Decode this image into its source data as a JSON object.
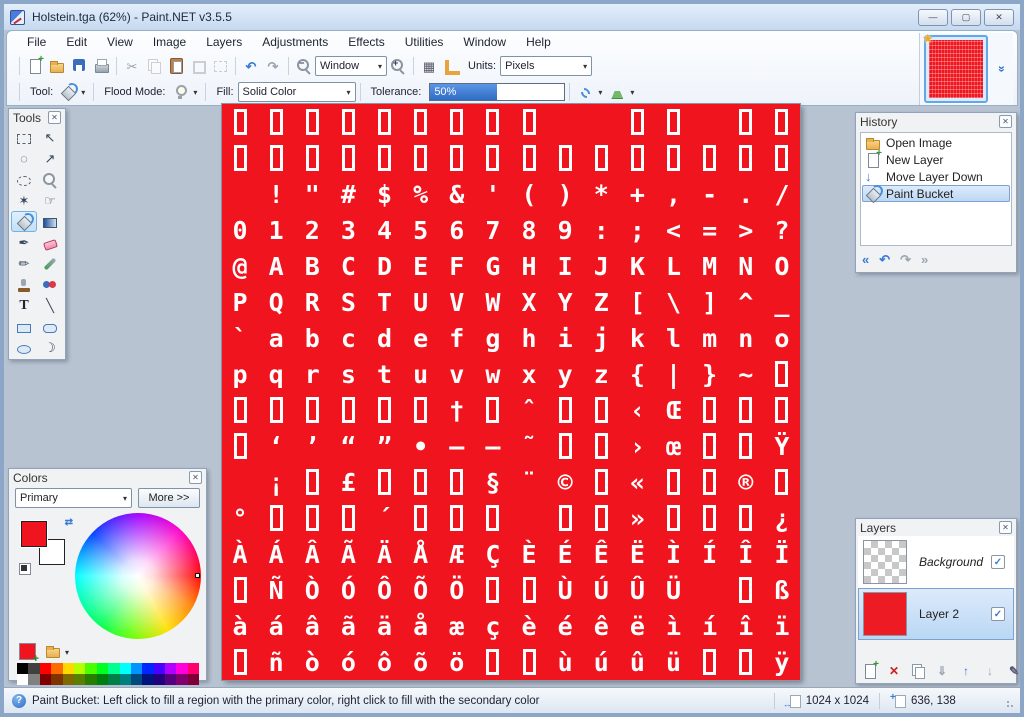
{
  "window": {
    "title": "Holstein.tga (62%) - Paint.NET v3.5.5"
  },
  "menu": {
    "items": [
      "File",
      "Edit",
      "View",
      "Image",
      "Layers",
      "Adjustments",
      "Effects",
      "Utilities",
      "Window",
      "Help"
    ]
  },
  "toolbar": {
    "zoom_mode_value": "Window",
    "units_label": "Units:",
    "units_value": "Pixels"
  },
  "tool_options": {
    "tool_label": "Tool:",
    "selected_tool": "Paint Bucket",
    "flood_mode_label": "Flood Mode:",
    "fill_label": "Fill:",
    "fill_value": "Solid Color",
    "tolerance_label": "Tolerance:",
    "tolerance_text": "50%",
    "tolerance_percent": 50
  },
  "icons": {
    "cut": "✂",
    "undo": "↶",
    "redo": "↷",
    "grid": "▦",
    "zoom_minus": "−",
    "zoom_plus": "+",
    "dropdown": "▾",
    "close_box": "✕",
    "star_badge": "★",
    "chevrons": "»",
    "minimize": "—",
    "maximize": "▢",
    "close": "✕",
    "help": "?",
    "check": "✓",
    "nav_rewind": "«",
    "nav_undo": "↶",
    "nav_redo": "↷",
    "nav_end": "»",
    "swap": "⇄",
    "add_layer_plus": "+",
    "delete_x": "✕",
    "arrow_up": "↑",
    "arrow_down": "↓",
    "merge_down": "⇓",
    "properties": "✎"
  },
  "tools_palette": {
    "title": "Tools",
    "tools": [
      {
        "name": "rectangle-select-tool",
        "glyph": "c:sel-rect"
      },
      {
        "name": "move-selected-pixels-tool",
        "glyph": "↖"
      },
      {
        "name": "lasso-select-tool",
        "glyph": "◌"
      },
      {
        "name": "move-selection-tool",
        "glyph": "↗"
      },
      {
        "name": "ellipse-select-tool",
        "glyph": "c:sel-ellipse"
      },
      {
        "name": "zoom-tool",
        "glyph": "c:i-mag"
      },
      {
        "name": "magic-wand-tool",
        "glyph": "✶"
      },
      {
        "name": "pan-tool",
        "glyph": "☞"
      },
      {
        "name": "paint-bucket-tool",
        "glyph": "c:i-bucket",
        "selected": true
      },
      {
        "name": "gradient-tool",
        "glyph": "c:grad"
      },
      {
        "name": "paintbrush-tool",
        "glyph": "✒"
      },
      {
        "name": "eraser-tool",
        "glyph": "c:eraser"
      },
      {
        "name": "pencil-tool",
        "glyph": "✏"
      },
      {
        "name": "color-picker-tool",
        "glyph": "c:dropper"
      },
      {
        "name": "clone-stamp-tool",
        "glyph": "c:stamp"
      },
      {
        "name": "recolor-tool",
        "glyph": "c:recolor"
      },
      {
        "name": "text-tool",
        "glyph": "T"
      },
      {
        "name": "line-curve-tool",
        "glyph": "╲"
      },
      {
        "name": "rectangle-tool",
        "glyph": "c:shape-rect"
      },
      {
        "name": "rounded-rectangle-tool",
        "glyph": "c:shape-rrect"
      },
      {
        "name": "ellipse-tool",
        "glyph": "c:shape-ellipse"
      },
      {
        "name": "freeform-shape-tool",
        "glyph": "☽"
      }
    ]
  },
  "colors_palette": {
    "title": "Colors",
    "mode_value": "Primary",
    "more_label": "More >>",
    "primary_color": "#f0141e",
    "secondary_color": "#ffffff",
    "swatches_row1": [
      "#000000",
      "#404040",
      "#FF0000",
      "#FF6A00",
      "#FFD800",
      "#B6FF00",
      "#4CFF00",
      "#00FF21",
      "#00FF90",
      "#00FFFF",
      "#0094FF",
      "#0026FF",
      "#4800FF",
      "#B200FF",
      "#FF00DC",
      "#FF006E"
    ],
    "swatches_row2": [
      "#FFFFFF",
      "#808080",
      "#7F0000",
      "#7F3300",
      "#7F6A00",
      "#5B7F00",
      "#267F00",
      "#007F0E",
      "#007F46",
      "#007F7F",
      "#004A7F",
      "#00137F",
      "#21007F",
      "#57007F",
      "#7F006E",
      "#7F0037"
    ]
  },
  "history_palette": {
    "title": "History",
    "items": [
      {
        "label": "Open Image",
        "icon": "open"
      },
      {
        "label": "New Layer",
        "icon": "new-layer"
      },
      {
        "label": "Move Layer Down",
        "icon": "move-down"
      },
      {
        "label": "Paint Bucket",
        "icon": "paint-bucket",
        "selected": true
      }
    ]
  },
  "layers_palette": {
    "title": "Layers",
    "layers": [
      {
        "name": "Background",
        "thumb": "checker",
        "visible": true,
        "italic": true
      },
      {
        "name": "Layer 2",
        "thumb": "color",
        "color": "#ed1c24",
        "visible": true,
        "selected": true
      }
    ]
  },
  "status_bar": {
    "message": "Paint Bucket: Left click to fill a region with the primary color, right click to fill with the secondary color",
    "image_size": "1024 x 1024",
    "cursor_position": "636, 138"
  },
  "canvas": {
    "zoom": "62%",
    "background": "#f0141e",
    "glyph_color": "#ffffff",
    "grid": [
      [
        "▯",
        "▯",
        "▯",
        "▯",
        "▯",
        "▯",
        "▯",
        "▯",
        "▯",
        "",
        "",
        "▯",
        "▯",
        "",
        "▯",
        "▯"
      ],
      [
        "▯",
        "▯",
        "▯",
        "▯",
        "▯",
        "▯",
        "▯",
        "▯",
        "▯",
        "▯",
        "▯",
        "▯",
        "▯",
        "▯",
        "▯",
        "▯"
      ],
      [
        "",
        "!",
        "\"",
        "#",
        "$",
        "%",
        "&",
        "'",
        "(",
        ")",
        "*",
        "+",
        ",",
        "-",
        ".",
        "/"
      ],
      [
        "0",
        "1",
        "2",
        "3",
        "4",
        "5",
        "6",
        "7",
        "8",
        "9",
        ":",
        ";",
        "<",
        "=",
        ">",
        "?"
      ],
      [
        "@",
        "A",
        "B",
        "C",
        "D",
        "E",
        "F",
        "G",
        "H",
        "I",
        "J",
        "K",
        "L",
        "M",
        "N",
        "O"
      ],
      [
        "P",
        "Q",
        "R",
        "S",
        "T",
        "U",
        "V",
        "W",
        "X",
        "Y",
        "Z",
        "[",
        "\\",
        "]",
        "^",
        "_"
      ],
      [
        "`",
        "a",
        "b",
        "c",
        "d",
        "e",
        "f",
        "g",
        "h",
        "i",
        "j",
        "k",
        "l",
        "m",
        "n",
        "o"
      ],
      [
        "p",
        "q",
        "r",
        "s",
        "t",
        "u",
        "v",
        "w",
        "x",
        "y",
        "z",
        "{",
        "|",
        "}",
        "~",
        "▯"
      ],
      [
        "▯",
        "▯",
        "▯",
        "▯",
        "▯",
        "▯",
        "†",
        "▯",
        "ˆ",
        "▯",
        "▯",
        "‹",
        "Œ",
        "▯",
        "▯",
        "▯"
      ],
      [
        "▯",
        "‘",
        "’",
        "“",
        "”",
        "•",
        "–",
        "—",
        "˜",
        "▯",
        "▯",
        "›",
        "œ",
        "▯",
        "▯",
        "Ÿ"
      ],
      [
        "",
        "¡",
        "▯",
        "£",
        "▯",
        "▯",
        "▯",
        "§",
        "¨",
        "©",
        "▯",
        "«",
        "▯",
        "▯",
        "®",
        "▯"
      ],
      [
        "°",
        "▯",
        "▯",
        "▯",
        "´",
        "▯",
        "▯",
        "▯",
        "",
        "▯",
        "▯",
        "»",
        "▯",
        "▯",
        "▯",
        "¿"
      ],
      [
        "À",
        "Á",
        "Â",
        "Ã",
        "Ä",
        "Å",
        "Æ",
        "Ç",
        "È",
        "É",
        "Ê",
        "Ë",
        "Ì",
        "Í",
        "Î",
        "Ï"
      ],
      [
        "▯",
        "Ñ",
        "Ò",
        "Ó",
        "Ô",
        "Õ",
        "Ö",
        "▯",
        "▯",
        "Ù",
        "Ú",
        "Û",
        "Ü",
        "",
        "▯",
        "ß"
      ],
      [
        "à",
        "á",
        "â",
        "ã",
        "ä",
        "å",
        "æ",
        "ç",
        "è",
        "é",
        "ê",
        "ë",
        "ì",
        "í",
        "î",
        "ï"
      ],
      [
        "▯",
        "ñ",
        "ò",
        "ó",
        "ô",
        "õ",
        "ö",
        "▯",
        "▯",
        "ù",
        "ú",
        "û",
        "ü",
        "▯",
        "▯",
        "ÿ"
      ]
    ]
  }
}
